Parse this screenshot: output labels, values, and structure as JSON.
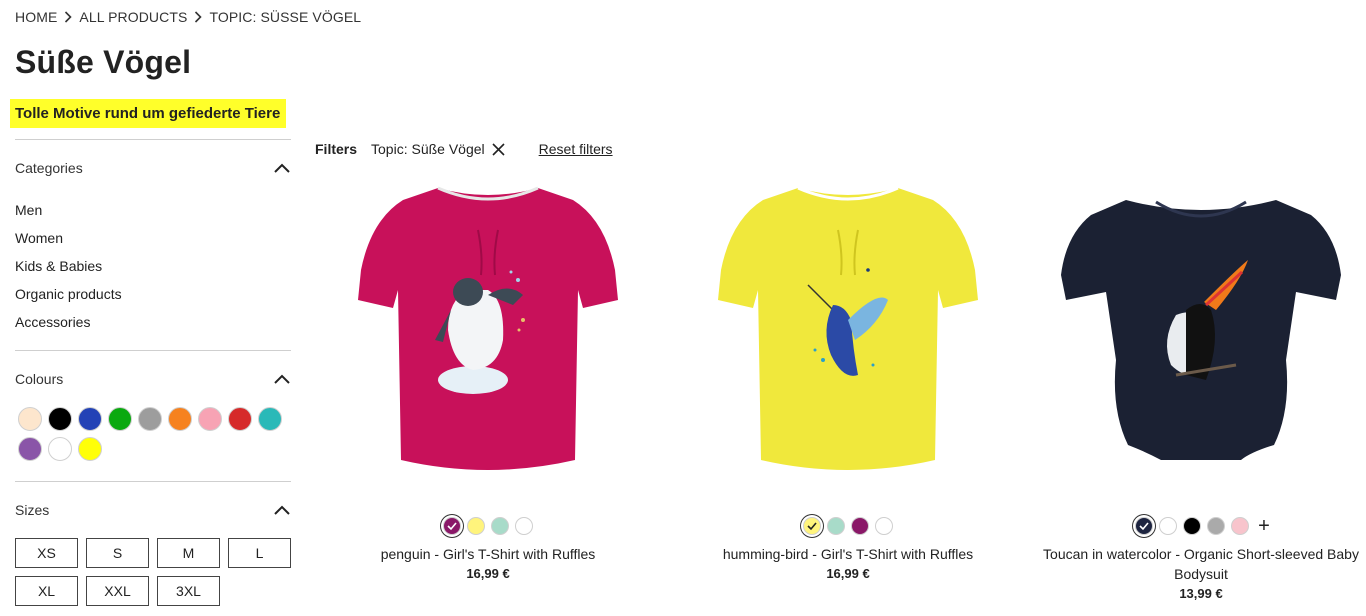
{
  "breadcrumb": [
    "HOME",
    "ALL PRODUCTS",
    "TOPIC: SÜSSE VÖGEL"
  ],
  "page_title": "Süße Vögel",
  "subtitle": "Tolle Motive rund um gefiederte Tiere",
  "sidebar": {
    "categories_title": "Categories",
    "categories": [
      "Men",
      "Women",
      "Kids & Babies",
      "Organic products",
      "Accessories"
    ],
    "colours_title": "Colours",
    "colours": [
      "#fde6cd",
      "#000000",
      "#2342b6",
      "#0aa90f",
      "#9d9d9d",
      "#f6821f",
      "#f7a3b4",
      "#d62a2a",
      "#2ab9b8",
      "#8a55a8",
      "#ffffff",
      "#ffff08"
    ],
    "sizes_title": "Sizes",
    "sizes": [
      "XS",
      "S",
      "M",
      "L",
      "XL",
      "XXL",
      "3XL"
    ]
  },
  "filters": {
    "label": "Filters",
    "chip": "Topic: Süße Vögel",
    "reset": "Reset filters"
  },
  "products": [
    {
      "name": "penguin - Girl's T-Shirt with Ruffles",
      "price": "16,99 €",
      "colours": [
        "#8a1868",
        "#fff47c",
        "#a8dbc9",
        "#ffffff"
      ],
      "selected": 0,
      "more": false
    },
    {
      "name": "humming-bird - Girl's T-Shirt with Ruffles",
      "price": "16,99 €",
      "colours": [
        "#fff47c",
        "#a8dbc9",
        "#8a1868",
        "#ffffff"
      ],
      "selected": 0,
      "more": false
    },
    {
      "name": "Toucan in watercolor - Organic Short-sleeved Baby Bodysuit",
      "price": "13,99 €",
      "colours": [
        "#1d2440",
        "#ffffff",
        "#000000",
        "#aaaaaa",
        "#f8c4cc"
      ],
      "selected": 0,
      "more": true,
      "more_label": "+"
    }
  ]
}
